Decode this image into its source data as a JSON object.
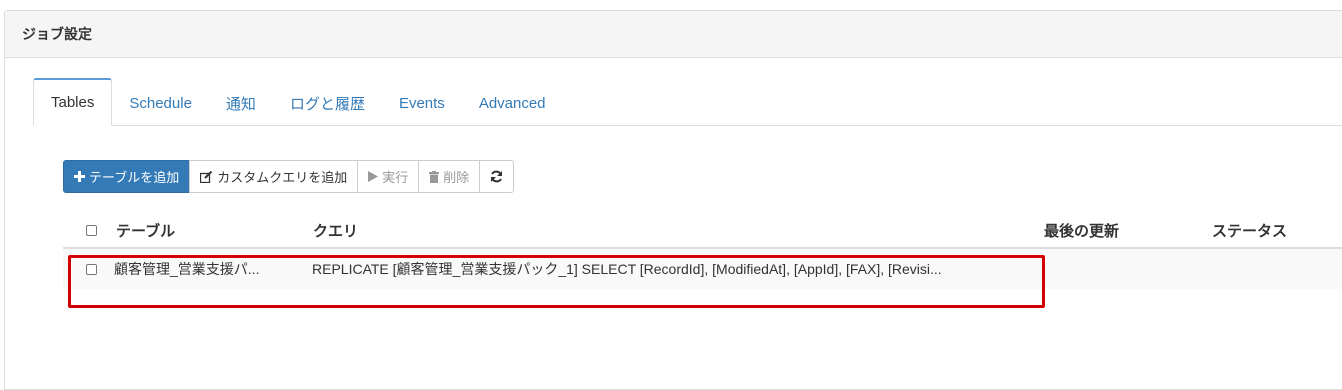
{
  "panel": {
    "title": "ジョブ設定"
  },
  "tabs": [
    {
      "label": "Tables",
      "active": true
    },
    {
      "label": "Schedule",
      "active": false
    },
    {
      "label": "通知",
      "active": false
    },
    {
      "label": "ログと履歴",
      "active": false
    },
    {
      "label": "Events",
      "active": false
    },
    {
      "label": "Advanced",
      "active": false
    }
  ],
  "toolbar": {
    "add_table": {
      "icon": "plus-icon",
      "label": "テーブルを追加"
    },
    "add_query": {
      "icon": "edit-icon",
      "label": "カスタムクエリを追加"
    },
    "run": {
      "icon": "play-icon",
      "label": "実行"
    },
    "delete": {
      "icon": "trash-icon",
      "label": "削除"
    },
    "refresh": {
      "icon": "refresh-icon"
    }
  },
  "table": {
    "columns": [
      "テーブル",
      "クエリ",
      "最後の更新",
      "ステータス"
    ],
    "rows": [
      {
        "table": "顧客管理_営業支援パ...",
        "query": "REPLICATE [顧客管理_営業支援パック_1] SELECT [RecordId], [ModifiedAt], [AppId], [FAX], [Revisi...",
        "last_updated": "",
        "status": ""
      }
    ]
  },
  "colors": {
    "primary": "#337ab7",
    "link": "#337ab7",
    "highlight": "#d40000"
  }
}
